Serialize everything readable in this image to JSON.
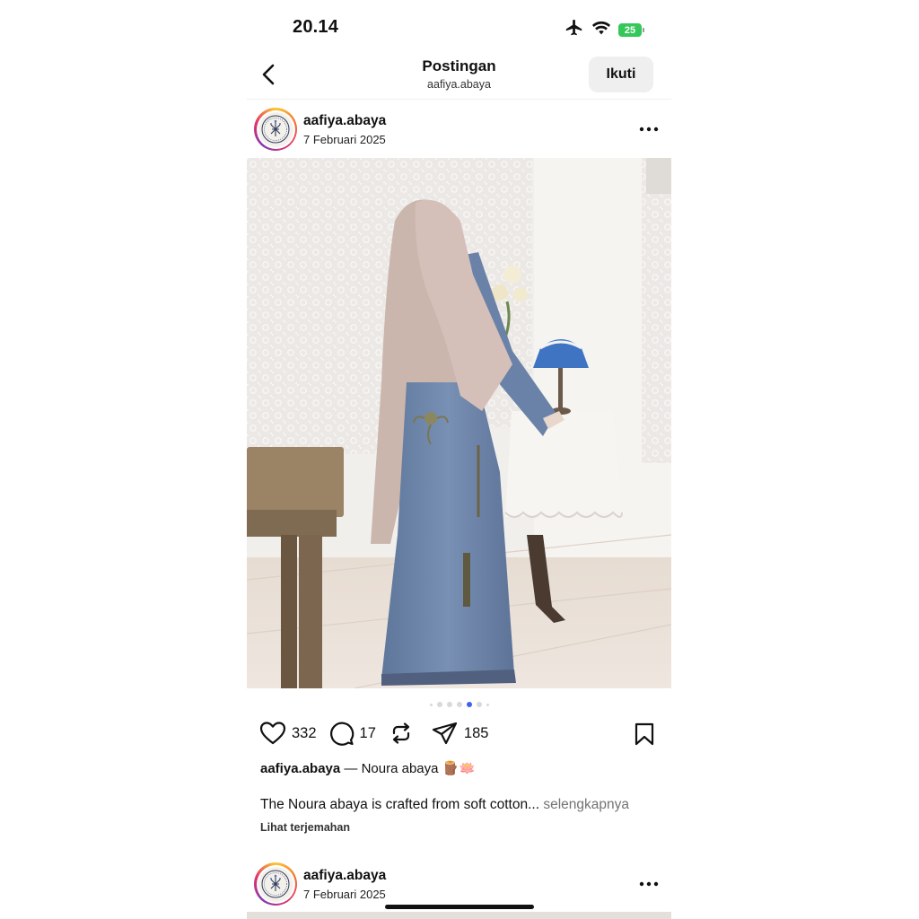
{
  "status_bar": {
    "time": "20.14",
    "battery": "25"
  },
  "header": {
    "title": "Postingan",
    "subtitle": "aafiya.abaya",
    "follow_label": "Ikuti"
  },
  "post": {
    "username": "aafiya.abaya",
    "date": "7 Februari 2025",
    "carousel": {
      "count": 7,
      "active_index": 4
    },
    "likes": "332",
    "comments": "17",
    "shares": "185",
    "caption_user": "aafiya.abaya",
    "caption_title": "— Noura abaya 🪵🪷",
    "caption_text": "The Noura abaya is crafted from soft cotton...",
    "more_label": "selengkapnya",
    "translate_label": "Lihat terjemahan"
  },
  "next_post": {
    "username": "aafiya.abaya",
    "date": "7 Februari 2025"
  },
  "colors": {
    "accent": "#3b63f0",
    "abaya": "#6f86ab",
    "hijab": "#c9b3ab"
  }
}
